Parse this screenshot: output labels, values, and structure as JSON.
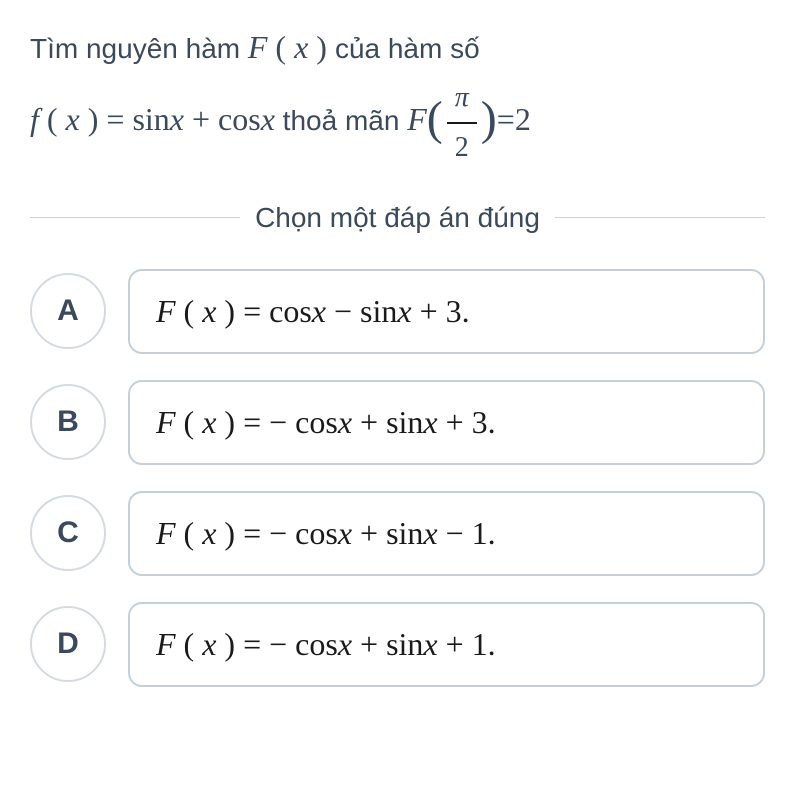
{
  "question": {
    "line1_prefix": "Tìm nguyên hàm ",
    "line1_suffix": " của hàm số",
    "line2_mid": " thoả mãn ",
    "F": "F",
    "x": "x",
    "f": "f",
    "sin": "sin",
    "cos": "cos",
    "pi": "π",
    "two": "2",
    "eq2": "2",
    "plus": "+",
    "eq": "="
  },
  "instruction": "Chọn một đáp án đúng",
  "options": [
    {
      "letter": "A",
      "formula": "F ( x ) = cosx − sinx + 3."
    },
    {
      "letter": "B",
      "formula": "F ( x ) = − cosx + sinx + 3."
    },
    {
      "letter": "C",
      "formula": "F ( x ) = − cosx + sinx − 1."
    },
    {
      "letter": "D",
      "formula": "F ( x ) = − cosx + sinx + 1."
    }
  ]
}
